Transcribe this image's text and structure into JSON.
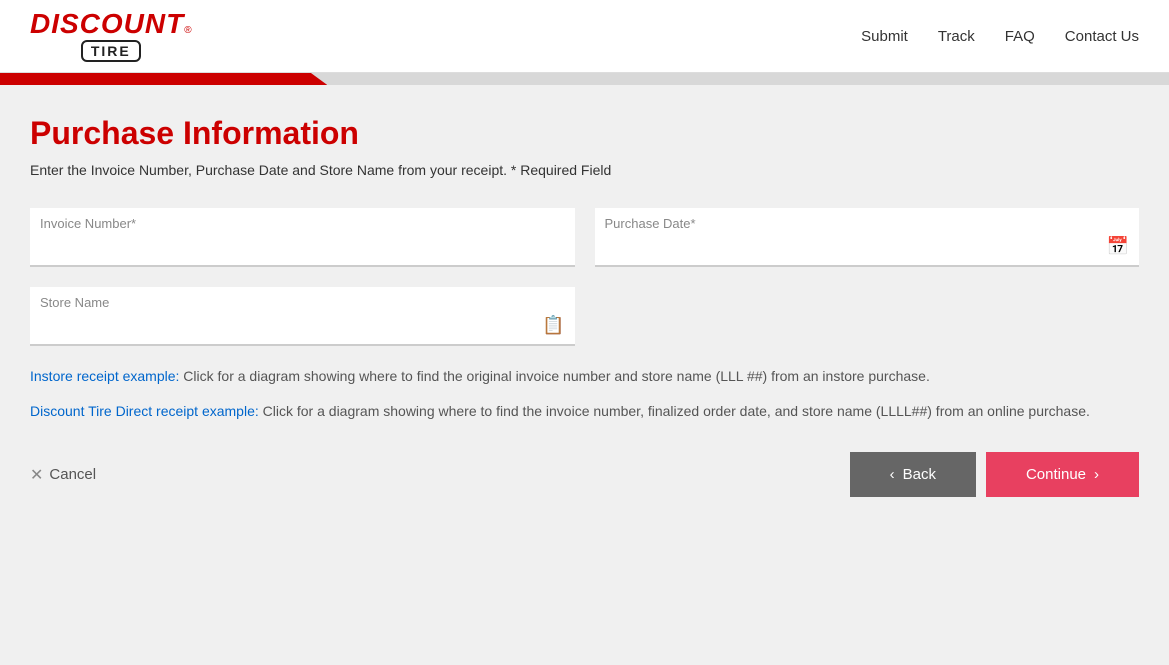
{
  "header": {
    "logo_main": "DISCOUNT",
    "logo_sub": "TIRE",
    "logo_reg": "®",
    "nav": {
      "submit": "Submit",
      "track": "Track",
      "faq": "FAQ",
      "contact": "Contact Us"
    }
  },
  "progress": {
    "fill_percent": "28%"
  },
  "form": {
    "title": "Purchase Information",
    "subtitle": "Enter the Invoice Number, Purchase Date and Store Name from your receipt. * Required Field",
    "invoice_label": "Invoice Number*",
    "invoice_value": "",
    "purchase_date_label": "Purchase Date*",
    "purchase_date_value": "",
    "store_name_label": "Store Name",
    "store_name_value": ""
  },
  "receipt_examples": {
    "instore_label": "Instore receipt example:",
    "instore_text": "Click for a diagram showing where to find the original invoice number and store name (LLL  ##) from an instore purchase.",
    "direct_label": "Discount Tire Direct receipt example:",
    "direct_text": "Click for a diagram showing where to find the invoice number, finalized order date, and store name (LLLL##) from an online purchase."
  },
  "buttons": {
    "cancel": "Cancel",
    "back": "Back",
    "continue": "Continue"
  }
}
